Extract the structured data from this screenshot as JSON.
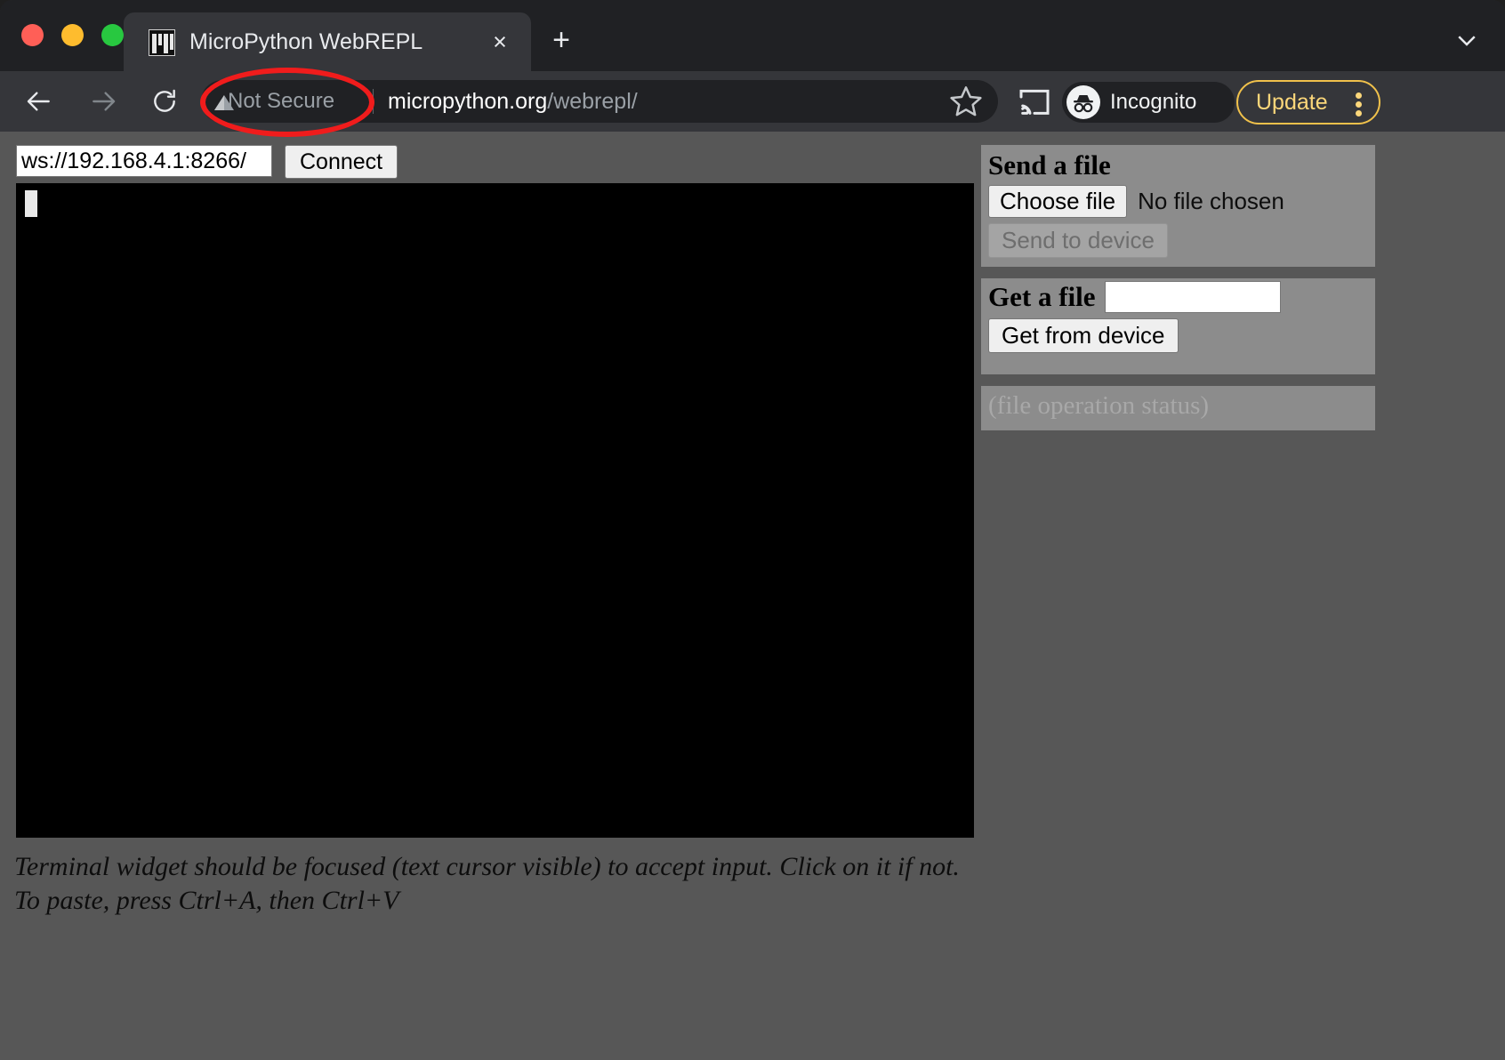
{
  "browser": {
    "tab": {
      "title": "MicroPython WebREPL",
      "favicon_name": "micropython-logo-icon",
      "close_label": "×"
    },
    "new_tab_label": "+",
    "toolbar": {
      "back_icon": "back-arrow-icon",
      "forward_icon": "forward-arrow-icon",
      "reload_icon": "reload-icon",
      "security_label": "Not Secure",
      "security_icon": "warning-triangle-icon",
      "url_host": "micropython.org",
      "url_path": "/webrepl/",
      "bookmark_icon": "star-icon",
      "cast_icon": "cast-icon",
      "profile_label": "Incognito",
      "profile_icon": "incognito-hat-glasses-icon",
      "update_label": "Update",
      "menu_icon": "three-dot-menu-icon"
    },
    "colors": {
      "tabstrip_bg": "#202124",
      "toolbar_bg": "#35363a",
      "active_tab_bg": "#35363a",
      "update_accent": "#f0c14b",
      "annotation_red": "#f01c1c"
    }
  },
  "page": {
    "connection": {
      "url_value": "ws://192.168.4.1:8266/",
      "url_placeholder": "ws://192.168.4.1:8266/",
      "connect_label": "Connect"
    },
    "terminal": {
      "content": "",
      "cursor_visible": true,
      "background": "#000000"
    },
    "help_line1": "Terminal widget should be focused (text cursor visible) to accept input. Click on it if not.",
    "help_line2": "To paste, press Ctrl+A, then Ctrl+V",
    "send_panel": {
      "heading": "Send a file",
      "choose_file_label": "Choose file",
      "file_status": "No file chosen",
      "send_label": "Send to device",
      "send_disabled": true
    },
    "get_panel": {
      "heading": "Get a file",
      "filename_value": "",
      "filename_placeholder": "",
      "get_label": "Get from device"
    },
    "status_panel": {
      "text": "(file operation status)"
    }
  },
  "annotation": {
    "shape": "red-ellipse",
    "targets": "Not Secure"
  }
}
